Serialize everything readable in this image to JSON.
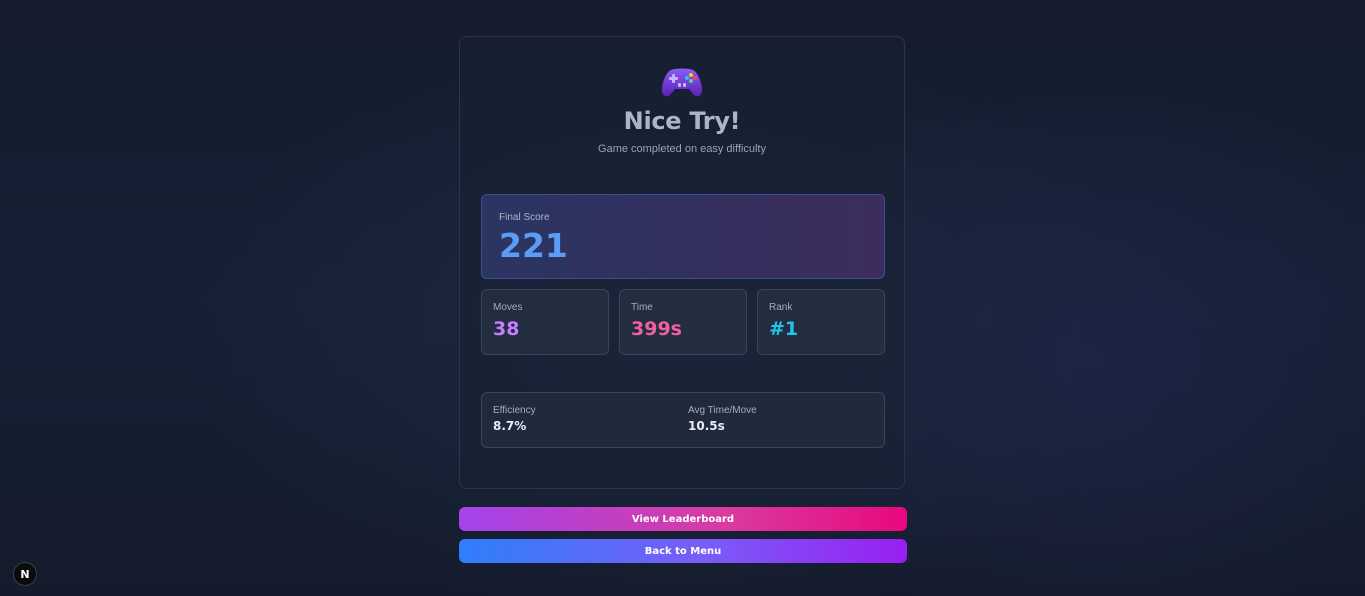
{
  "result": {
    "icon": "game-controller-icon",
    "title": "Nice Try!",
    "subtitle": "Game completed on easy difficulty"
  },
  "score": {
    "label": "Final Score",
    "value": "221",
    "color": "#5b9cf6"
  },
  "stats": [
    {
      "label": "Moves",
      "value": "38",
      "color": "#c77dff"
    },
    {
      "label": "Time",
      "value": "399s",
      "color": "#f0609e"
    },
    {
      "label": "Rank",
      "value": "#1",
      "color": "#22c3ee"
    }
  ],
  "metrics": [
    {
      "label": "Efficiency",
      "value": "8.7%"
    },
    {
      "label": "Avg Time/Move",
      "value": "10.5s"
    }
  ],
  "actions": {
    "leaderboard_label": "View Leaderboard",
    "menu_label": "Back to Menu"
  },
  "dev_badge": {
    "icon": "nextjs-logo-icon",
    "letter": "N"
  }
}
